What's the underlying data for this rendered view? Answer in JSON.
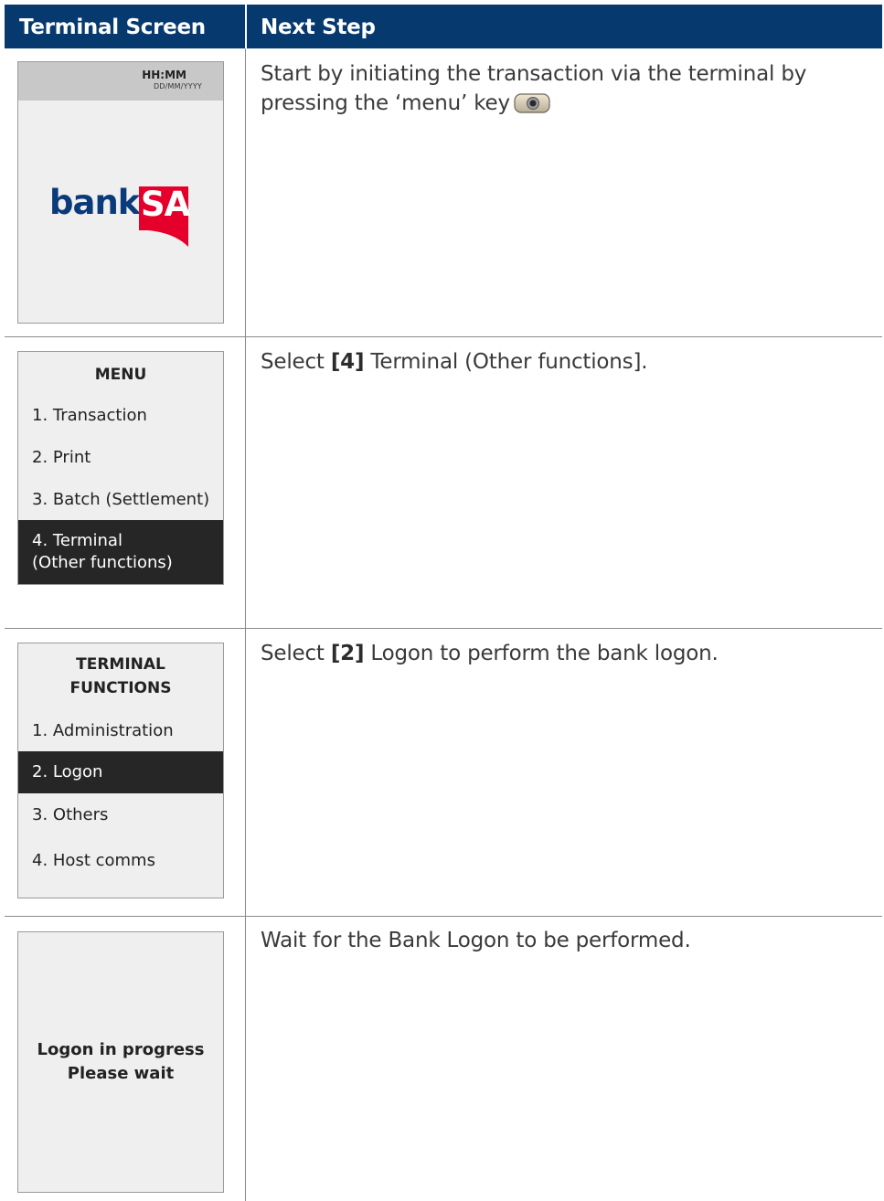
{
  "table": {
    "header": {
      "left": "Terminal Screen",
      "right": "Next Step"
    },
    "colors": {
      "header_bg": "#06396e",
      "screen_bg": "#efefef",
      "selected_bg": "#262626",
      "logo_blue": "#0b3a7a",
      "logo_red": "#e4002b"
    }
  },
  "rows": [
    {
      "screen": {
        "time": "HH:MM",
        "date": "DD/MM/YYYY",
        "logo": {
          "part1": "bank",
          "part2": "SA"
        }
      },
      "step": {
        "text": "Start by initiating the transaction via the terminal by pressing the ‘menu’ key",
        "icon": "menu-key-icon"
      }
    },
    {
      "screen": {
        "title": "MENU",
        "items": [
          "1. Transaction",
          "2. Print",
          "3. Batch (Settlement)",
          "4. Terminal\n(Other functions)"
        ],
        "selected_index": 3
      },
      "step": {
        "prefix": "Select ",
        "key": "[4]",
        "suffix": " Terminal (Other functions]."
      }
    },
    {
      "screen": {
        "title": "TERMINAL\nFUNCTIONS",
        "items": [
          "1. Administration",
          "2. Logon",
          "3. Others",
          "4. Host comms"
        ],
        "selected_index": 1
      },
      "step": {
        "prefix": "Select ",
        "key": "[2]",
        "suffix": " Logon to perform the bank logon."
      }
    },
    {
      "screen": {
        "message": "Logon in progress\nPlease wait"
      },
      "step": {
        "text": "Wait for the Bank Logon to be performed."
      }
    }
  ]
}
